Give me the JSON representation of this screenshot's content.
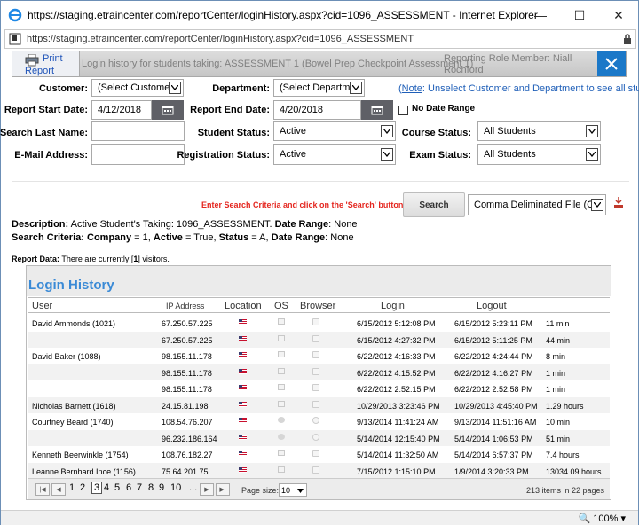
{
  "window": {
    "title": "https://staging.etraincenter.com/reportCenter/loginHistory.aspx?cid=1096_ASSESSMENT - Internet Explorer",
    "url": "https://staging.etraincenter.com/reportCenter/loginHistory.aspx?cid=1096_ASSESSMENT",
    "minimize": "—",
    "maximize": "☐",
    "close": "✕"
  },
  "header": {
    "print_label_1": "Print",
    "print_label_2": "Report",
    "message": "Login history for students taking: ASSESSMENT 1 (Bowel Prep Checkpoint Assessment 1)",
    "role": "Reporting Role Member: Niall Rochford"
  },
  "form": {
    "customer_label": "Customer:",
    "customer_value": "(Select Customer)",
    "department_label": "Department:",
    "department_value": "(Select Departmer",
    "note_link": "Note",
    "note_text": ": Unselect Customer and Department to see all students.)",
    "note_open": "(",
    "start_label": "Report Start Date:",
    "start_value": "4/12/2018",
    "end_label": "Report End Date:",
    "end_value": "4/20/2018",
    "no_date_range": "No Date Range",
    "last_name_label": "Search Last Name:",
    "last_name_value": "",
    "student_status_label": "Student Status:",
    "student_status_value": "Active",
    "course_status_label": "Course Status:",
    "course_status_value": "All Students",
    "email_label": "E-Mail Address:",
    "email_value": "",
    "reg_status_label": "Registration Status:",
    "reg_status_value": "Active",
    "exam_status_label": "Exam Status:",
    "exam_status_value": "All Students"
  },
  "actions": {
    "hint": "Enter Search Criteria and click on the 'Search' button.",
    "search": "Search",
    "export_value": "Comma Deliminated File (CS"
  },
  "summary": {
    "desc_label": "Description:",
    "desc_text": " Active Student's Taking: 1096_ASSESSMENT. ",
    "date_range_label": "Date Range",
    "date_range_text": ": None",
    "crit_label": "Search Criteria:",
    "crit_company_label": " Company",
    "crit_company_text": " = 1, ",
    "crit_active_label": "Active",
    "crit_active_text": " = True, ",
    "crit_status_label": "Status",
    "crit_status_text": " = A, ",
    "crit_dr_label": "Date Range",
    "crit_dr_text": ": None",
    "report_label": "Report Data:",
    "report_text": "  There are currently [",
    "visitors_count": "1",
    "report_end": "] visitors."
  },
  "grid": {
    "title": "Login History",
    "columns": [
      "User",
      "IP Address",
      "Location",
      "OS",
      "Browser",
      "Login",
      "Logout"
    ],
    "rows": [
      {
        "user": "David Ammonds (1021)",
        "ip": "67.250.57.225",
        "os": "pc",
        "browser": "box",
        "login": "6/15/2012 5:12:08 PM",
        "logout": "6/15/2012 5:23:11 PM",
        "duration": "11 min"
      },
      {
        "user": "",
        "ip": "67.250.57.225",
        "os": "pc",
        "browser": "box",
        "login": "6/15/2012 4:27:32 PM",
        "logout": "6/15/2012 5:11:25 PM",
        "duration": "44 min"
      },
      {
        "user": "David Baker (1088)",
        "ip": "98.155.11.178",
        "os": "pc",
        "browser": "box",
        "login": "6/22/2012 4:16:33 PM",
        "logout": "6/22/2012 4:24:44 PM",
        "duration": "8 min"
      },
      {
        "user": "",
        "ip": "98.155.11.178",
        "os": "pc",
        "browser": "box",
        "login": "6/22/2012 4:15:52 PM",
        "logout": "6/22/2012 4:16:27 PM",
        "duration": "1 min"
      },
      {
        "user": "",
        "ip": "98.155.11.178",
        "os": "pc",
        "browser": "box",
        "login": "6/22/2012 2:52:15 PM",
        "logout": "6/22/2012 2:52:58 PM",
        "duration": "1 min"
      },
      {
        "user": "Nicholas Barnett (1618)",
        "ip": "24.15.81.198",
        "os": "pc",
        "browser": "box",
        "login": "10/29/2013 3:23:46 PM",
        "logout": "10/29/2013 4:45:40 PM",
        "duration": "1.29 hours"
      },
      {
        "user": "Courtney Beard (1740)",
        "ip": "108.54.76.207",
        "os": "apple",
        "browser": "circle",
        "login": "9/13/2014 11:41:24 AM",
        "logout": "9/13/2014 11:51:16 AM",
        "duration": "10 min"
      },
      {
        "user": "",
        "ip": "96.232.186.164",
        "os": "apple",
        "browser": "circle",
        "login": "5/14/2014 12:15:40 PM",
        "logout": "5/14/2014 1:06:53 PM",
        "duration": "51 min"
      },
      {
        "user": "Kenneth Beerwinkle (1754)",
        "ip": "108.76.182.27",
        "os": "pc",
        "browser": "box",
        "login": "5/14/2014 11:32:50 AM",
        "logout": "5/14/2014 6:57:37 PM",
        "duration": "7.4 hours"
      },
      {
        "user": "Leanne Bernhard Ince (1156)",
        "ip": "75.64.201.75",
        "os": "pc",
        "browser": "box",
        "login": "7/15/2012 1:15:10 PM",
        "logout": "1/9/2014 3:20:33 PM",
        "duration": "13034.09 hours"
      }
    ]
  },
  "pager": {
    "pages": [
      "1",
      "2",
      "3",
      "4",
      "5",
      "6",
      "7",
      "8",
      "9",
      "10",
      "..."
    ],
    "current": "3",
    "page_size_label": "Page size:",
    "page_size_value": "10",
    "count_text": "213 items in 22 pages"
  },
  "status": {
    "zoom": "100%"
  }
}
